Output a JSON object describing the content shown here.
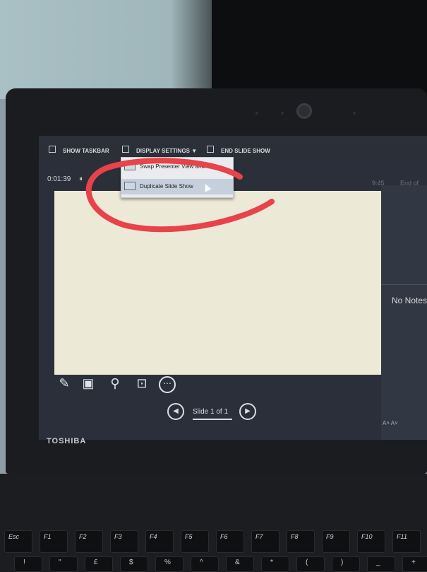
{
  "presenter": {
    "toolbar": {
      "show_taskbar": "SHOW TASKBAR",
      "display_settings": "DISPLAY SETTINGS ▼",
      "end_slide_show": "END SLIDE SHOW"
    },
    "dropdown": {
      "items": [
        {
          "label": "Swap Presenter View and"
        },
        {
          "label": "Duplicate Slide Show"
        }
      ]
    },
    "timer": "0:01:39",
    "pause_glyph": "⏸",
    "clock": "9:45",
    "end_of_show": "End of",
    "notes": "No Notes",
    "font_size_controls": "A˄  A˅",
    "slide_counter": "Slide 1 of 1",
    "prev_glyph": "◀",
    "next_glyph": "▶"
  },
  "laptop": {
    "brand": "TOSHIBA"
  },
  "keyboard": {
    "fn_keys": [
      "Esc",
      "F1",
      "F2",
      "F3",
      "F4",
      "F5",
      "F6",
      "F7",
      "F8",
      "F9",
      "F10",
      "F11"
    ],
    "number_keys": [
      "!",
      "\"",
      "£",
      "$",
      "%",
      "^",
      "&",
      "*",
      "(",
      ")",
      "_",
      "+"
    ]
  },
  "colors": {
    "annotation": "#e8424a",
    "slide_bg": "#ece9d6",
    "dropdown_highlight": "#c6d0dd"
  }
}
